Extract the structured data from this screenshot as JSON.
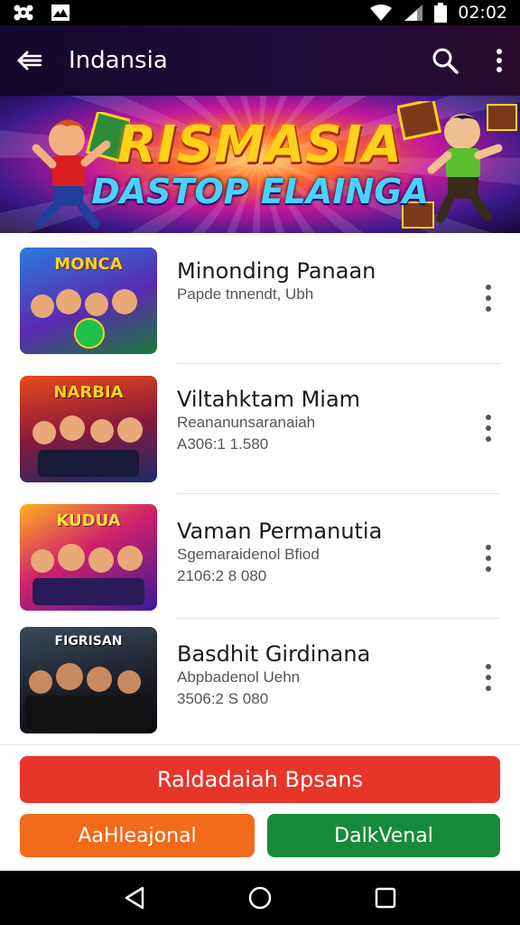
{
  "status": {
    "time": "02:02"
  },
  "app_bar": {
    "title": "Indansia"
  },
  "banner": {
    "line1": "RISMASIA",
    "line2": "DASTOP ELAINGA"
  },
  "items": [
    {
      "thumb_title": "MONCA",
      "title": "Minonding Panaan",
      "subtitle": "Papde tnnendt, Ubh",
      "meta": ""
    },
    {
      "thumb_title": "NARBIA",
      "title": "Viltahktam Miam",
      "subtitle": "Reananunsaranaiah",
      "meta": "A306:1 1.580"
    },
    {
      "thumb_title": "KUDUA",
      "title": "Vaman Permanutia",
      "subtitle": "Sgemaraidenol Bfiod",
      "meta": "2106:2 8 080"
    },
    {
      "thumb_title": "FIGRISAN",
      "title": "Basdhit Girdinana",
      "subtitle": "Abpbadenol Uehn",
      "meta": "3506:2 S 080"
    }
  ],
  "buttons": {
    "primary": "Raldadaiah Bpsans",
    "left": "AaHleajonal",
    "right": "DalkVenal"
  },
  "colors": {
    "primary_button": "#e8352a",
    "left_button": "#f26a1b",
    "right_button": "#168a3a",
    "app_bar": "#1a0b33"
  },
  "icons": [
    "back-arrow-icon",
    "search-icon",
    "more-vert-icon",
    "wifi-icon",
    "signal-icon",
    "battery-icon",
    "nav-back-icon",
    "nav-home-icon",
    "nav-recents-icon"
  ]
}
